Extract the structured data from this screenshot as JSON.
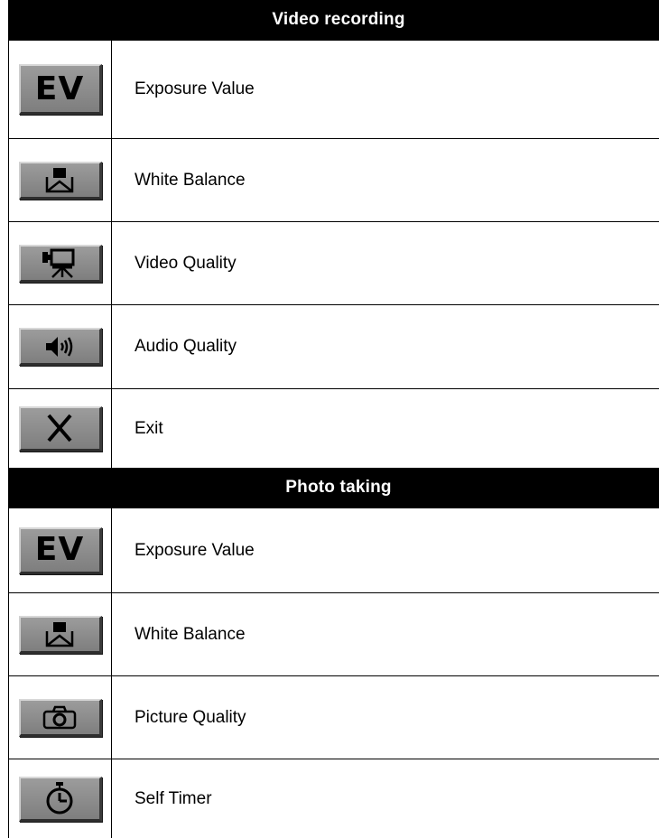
{
  "sections": {
    "video": {
      "title": "Video recording",
      "rows": [
        {
          "icon": "ev-icon",
          "label": "Exposure Value",
          "icon_text": "EV"
        },
        {
          "icon": "white-balance-icon",
          "label": "White Balance"
        },
        {
          "icon": "video-camera-icon",
          "label": "Video Quality"
        },
        {
          "icon": "speaker-icon",
          "label": "Audio Quality"
        },
        {
          "icon": "close-icon",
          "label": "Exit"
        }
      ]
    },
    "photo": {
      "title": "Photo taking",
      "rows": [
        {
          "icon": "ev-icon",
          "label": "Exposure Value",
          "icon_text": "EV"
        },
        {
          "icon": "white-balance-icon",
          "label": "White Balance"
        },
        {
          "icon": "camera-icon",
          "label": "Picture Quality"
        },
        {
          "icon": "timer-icon",
          "label": "Self Timer"
        }
      ]
    }
  }
}
